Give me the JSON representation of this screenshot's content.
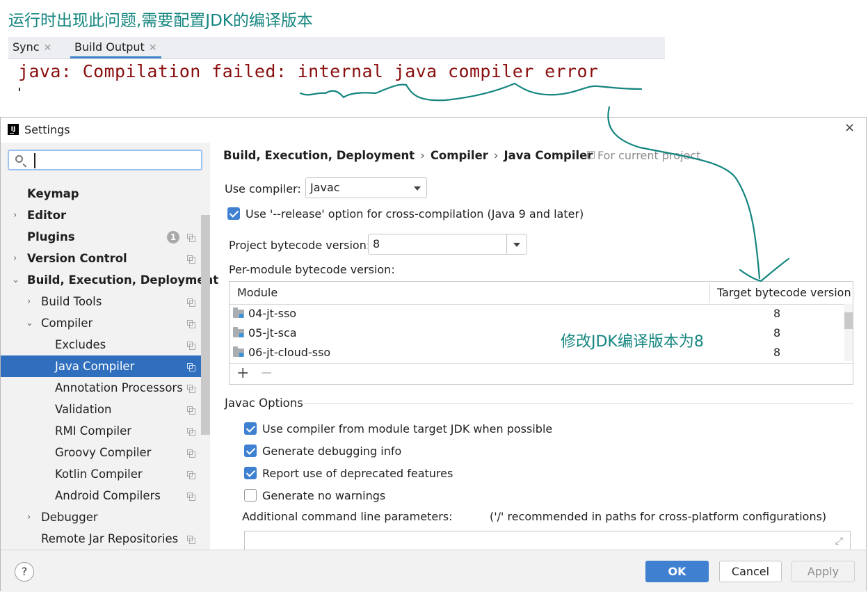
{
  "annotations": {
    "top_note": "运行时出现此问题,需要配置JDK的编译版本",
    "handwritten_note": "修改JDK编译版本为8"
  },
  "build_tabs": {
    "sync": "Sync",
    "build_output": "Build Output"
  },
  "error_text": "java: Compilation failed: internal java compiler error",
  "dialog": {
    "title": "Settings",
    "search": {
      "value": "",
      "placeholder": ""
    },
    "tree": [
      {
        "label": "Keymap"
      },
      {
        "label": "Editor"
      },
      {
        "label": "Plugins",
        "badge": "1"
      },
      {
        "label": "Version Control"
      },
      {
        "label": "Build, Execution, Deployment"
      },
      {
        "label": "Build Tools"
      },
      {
        "label": "Compiler"
      },
      {
        "label": "Excludes"
      },
      {
        "label": "Java Compiler",
        "selected": true
      },
      {
        "label": "Annotation Processors"
      },
      {
        "label": "Validation"
      },
      {
        "label": "RMI Compiler"
      },
      {
        "label": "Groovy Compiler"
      },
      {
        "label": "Kotlin Compiler"
      },
      {
        "label": "Android Compilers"
      },
      {
        "label": "Debugger"
      },
      {
        "label": "Remote Jar Repositories"
      }
    ],
    "breadcrumb": [
      "Build, Execution, Deployment",
      "Compiler",
      "Java Compiler"
    ],
    "breadcrumb_sep": "›",
    "for_current_project": "For current project",
    "use_compiler_label": "Use compiler:",
    "use_compiler_value": "Javac",
    "release_option": "Use '--release' option for cross-compilation (Java 9 and later)",
    "project_bytecode_label": "Project bytecode version:",
    "project_bytecode_value": "8",
    "per_module_label": "Per-module bytecode version:",
    "table": {
      "headers": [
        "Module",
        "Target bytecode version"
      ],
      "rows": [
        {
          "module": "04-jt-sso",
          "version": "8"
        },
        {
          "module": "05-jt-sca",
          "version": "8"
        },
        {
          "module": "06-jt-cloud-sso",
          "version": "8"
        }
      ],
      "add": "+",
      "remove": "−"
    },
    "javac_options_title": "Javac Options",
    "options": [
      {
        "label": "Use compiler from module target JDK when possible",
        "checked": true
      },
      {
        "label": "Generate debugging info",
        "checked": true
      },
      {
        "label": "Report use of deprecated features",
        "checked": true
      },
      {
        "label": "Generate no warnings",
        "checked": false
      }
    ],
    "additional_params_label": "Additional command line parameters:",
    "additional_params_hint": "('/' recommended in paths for cross-platform configurations)",
    "additional_params_value": "",
    "buttons": {
      "help": "?",
      "ok": "OK",
      "cancel": "Cancel",
      "apply": "Apply"
    },
    "close": "×"
  },
  "colors": {
    "annotation": "#14857f",
    "accent": "#3f80d0",
    "selection": "#2f6fbd",
    "error": "#8a0e0e"
  }
}
